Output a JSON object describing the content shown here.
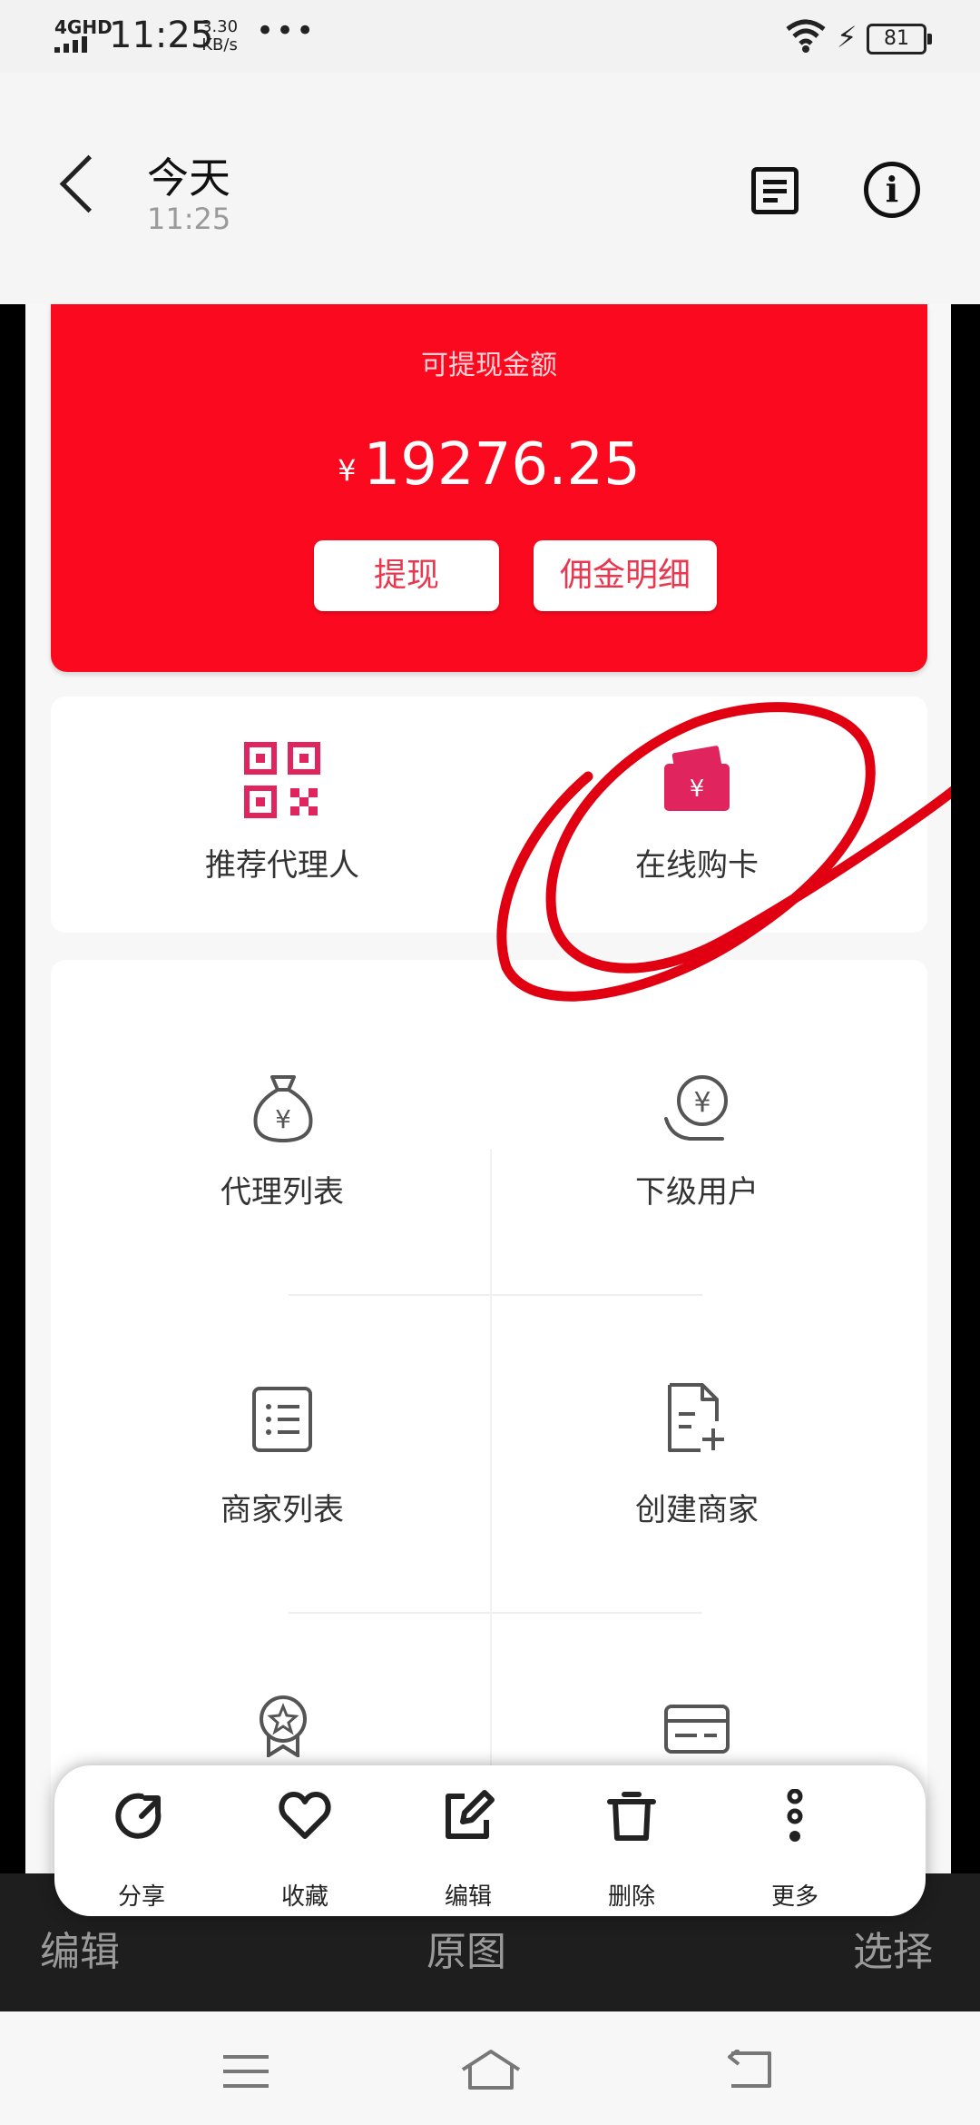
{
  "status_bar": {
    "network": "4GHD",
    "time": "11:25",
    "speed_value": "3.30",
    "speed_unit": "KB/s",
    "more": "•••",
    "battery": "81"
  },
  "header": {
    "title": "今天",
    "subtitle": "11:25"
  },
  "card": {
    "label": "可提现金额",
    "currency": "¥",
    "amount": "19276.25",
    "withdraw_label": "提现",
    "commission_label": "佣金明细"
  },
  "quick_actions": [
    {
      "label": "推荐代理人",
      "icon": "qr-code-icon"
    },
    {
      "label": "在线购卡",
      "icon": "card-wallet-icon"
    }
  ],
  "grid": [
    {
      "label": "代理列表",
      "icon": "money-bag-icon"
    },
    {
      "label": "下级用户",
      "icon": "yuan-hand-icon"
    },
    {
      "label": "商家列表",
      "icon": "list-icon"
    },
    {
      "label": "创建商家",
      "icon": "file-add-icon"
    }
  ],
  "under_bar": {
    "left": "编辑",
    "middle": "原图",
    "right": "选择"
  },
  "popup": [
    {
      "label": "分享",
      "icon": "share-icon"
    },
    {
      "label": "收藏",
      "icon": "heart-icon"
    },
    {
      "label": "编辑",
      "icon": "edit-icon"
    },
    {
      "label": "删除",
      "icon": "trash-icon"
    },
    {
      "label": "更多",
      "icon": "more-vertical-icon"
    }
  ],
  "colors": {
    "accent_red": "#fb0a1f",
    "button_text": "#e8374e",
    "icon_pink": "#e0245e"
  }
}
